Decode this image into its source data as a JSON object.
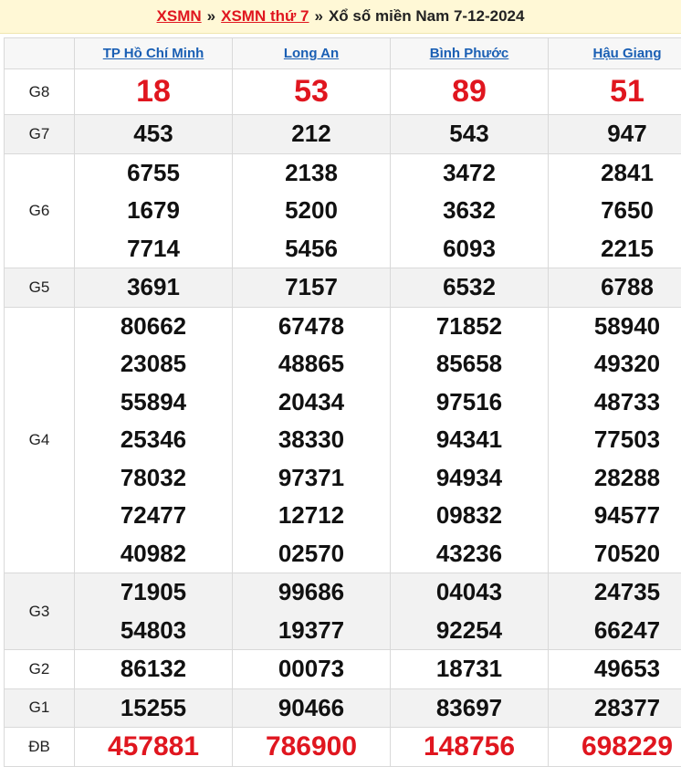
{
  "header": {
    "link1": "XSMN",
    "sep1": "»",
    "link2": "XSMN thứ 7",
    "sep2": "»",
    "title": "Xổ số miền Nam 7-12-2024"
  },
  "provinces": [
    "TP Hồ Chí Minh",
    "Long An",
    "Bình Phước",
    "Hậu Giang"
  ],
  "prizes": [
    {
      "label": "G8",
      "results": [
        [
          "18"
        ],
        [
          "53"
        ],
        [
          "89"
        ],
        [
          "51"
        ]
      ]
    },
    {
      "label": "G7",
      "results": [
        [
          "453"
        ],
        [
          "212"
        ],
        [
          "543"
        ],
        [
          "947"
        ]
      ]
    },
    {
      "label": "G6",
      "results": [
        [
          "6755",
          "1679",
          "7714"
        ],
        [
          "2138",
          "5200",
          "5456"
        ],
        [
          "3472",
          "3632",
          "6093"
        ],
        [
          "2841",
          "7650",
          "2215"
        ]
      ]
    },
    {
      "label": "G5",
      "results": [
        [
          "3691"
        ],
        [
          "7157"
        ],
        [
          "6532"
        ],
        [
          "6788"
        ]
      ]
    },
    {
      "label": "G4",
      "results": [
        [
          "80662",
          "23085",
          "55894",
          "25346",
          "78032",
          "72477",
          "40982"
        ],
        [
          "67478",
          "48865",
          "20434",
          "38330",
          "97371",
          "12712",
          "02570"
        ],
        [
          "71852",
          "85658",
          "97516",
          "94341",
          "94934",
          "09832",
          "43236"
        ],
        [
          "58940",
          "49320",
          "48733",
          "77503",
          "28288",
          "94577",
          "70520"
        ]
      ]
    },
    {
      "label": "G3",
      "results": [
        [
          "71905",
          "54803"
        ],
        [
          "99686",
          "19377"
        ],
        [
          "04043",
          "92254"
        ],
        [
          "24735",
          "66247"
        ]
      ]
    },
    {
      "label": "G2",
      "results": [
        [
          "86132"
        ],
        [
          "00073"
        ],
        [
          "18731"
        ],
        [
          "49653"
        ]
      ]
    },
    {
      "label": "G1",
      "results": [
        [
          "15255"
        ],
        [
          "90466"
        ],
        [
          "83697"
        ],
        [
          "28377"
        ]
      ]
    },
    {
      "label": "ĐB",
      "results": [
        [
          "457881"
        ],
        [
          "786900"
        ],
        [
          "148756"
        ],
        [
          "698229"
        ]
      ]
    }
  ],
  "colors": {
    "accent_red": "#e0161f",
    "link_blue": "#1a5fb4",
    "title_bg": "#fff8d6"
  }
}
